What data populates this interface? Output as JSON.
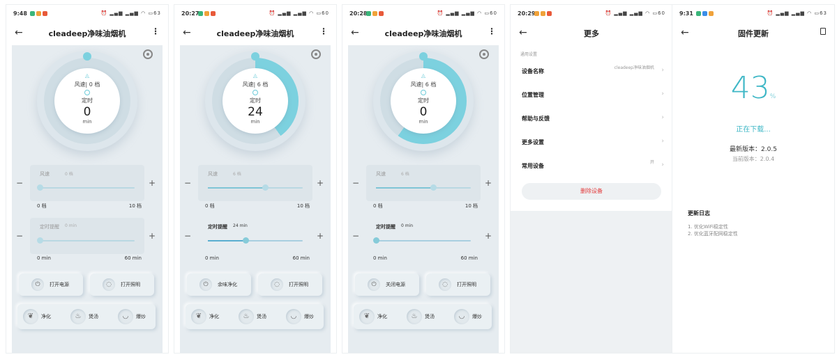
{
  "colors": {
    "accent": "#3fb7c6",
    "ring": "#7cd1df",
    "panel": "#e6ecf0",
    "danger": "#e23b3b"
  },
  "screens": [
    {
      "status": {
        "time": "9:48",
        "battery": "63"
      },
      "title": "cleadeep净味油烟机",
      "dial": {
        "speed": "风速| 0 档",
        "timer_label": "定时",
        "value": "0",
        "unit": "min",
        "arc_fraction": 0.0
      },
      "fan_slider": {
        "label": "风速",
        "value": "0 档",
        "min": "0 档",
        "max": "10 档",
        "fraction": 0.0
      },
      "timer_slider": {
        "label": "定时提醒",
        "value": "0 min",
        "min": "0 min",
        "max": "60 min",
        "fraction": 0.0
      },
      "buttons": [
        "打开电源",
        "打开照明"
      ],
      "modes": [
        "净化",
        "煲汤",
        "爆炒"
      ]
    },
    {
      "status": {
        "time": "20:27",
        "battery": "60"
      },
      "title": "cleadeep净味油烟机",
      "dial": {
        "speed": "风速| 6 档",
        "timer_label": "定时",
        "value": "24",
        "unit": "min",
        "arc_fraction": 0.4
      },
      "fan_slider": {
        "label": "风速",
        "value": "6 档",
        "min": "0 档",
        "max": "10 档",
        "fraction": 0.6
      },
      "timer_slider": {
        "label": "定时提醒",
        "value": "24 min",
        "min": "0 min",
        "max": "60 min",
        "fraction": 0.4
      },
      "buttons": [
        "余味净化",
        "打开照明"
      ],
      "modes": [
        "净化",
        "煲汤",
        "爆炒"
      ]
    },
    {
      "status": {
        "time": "20:28",
        "battery": "60"
      },
      "title": "cleadeep净味油烟机",
      "dial": {
        "speed": "风速| 6 档",
        "timer_label": "定时",
        "value": "0",
        "unit": "min",
        "arc_fraction": 0.6
      },
      "fan_slider": {
        "label": "风速",
        "value": "6 档",
        "min": "0 档",
        "max": "10 档",
        "fraction": 0.6
      },
      "timer_slider": {
        "label": "定时提醒",
        "value": "0 min",
        "min": "0 min",
        "max": "60 min",
        "fraction": 0.0
      },
      "buttons": [
        "关闭电源",
        "打开照明"
      ],
      "modes": [
        "净化",
        "煲汤",
        "爆炒"
      ]
    }
  ],
  "more": {
    "status": {
      "time": "20:29",
      "battery": "60"
    },
    "title": "更多",
    "section": "通用设置",
    "rows": [
      {
        "name": "设备名称",
        "value": "cleadeep净味油烟机"
      },
      {
        "name": "位置管理",
        "value": ""
      },
      {
        "name": "帮助与反馈",
        "value": ""
      },
      {
        "name": "更多设置",
        "value": ""
      },
      {
        "name": "常用设备",
        "value": "开"
      }
    ],
    "delete": "删除设备"
  },
  "firmware": {
    "status": {
      "time": "9:31",
      "battery": "63"
    },
    "title": "固件更新",
    "percent": "43",
    "percent_sign": "%",
    "downloading": "正在下载...",
    "latest": "最新版本：2.0.5",
    "current": "当前版本：2.0.4",
    "log_title": "更新日志",
    "log": [
      "1. 优化WiFi稳定性",
      "2. 优化蓝牙配网稳定性"
    ]
  }
}
